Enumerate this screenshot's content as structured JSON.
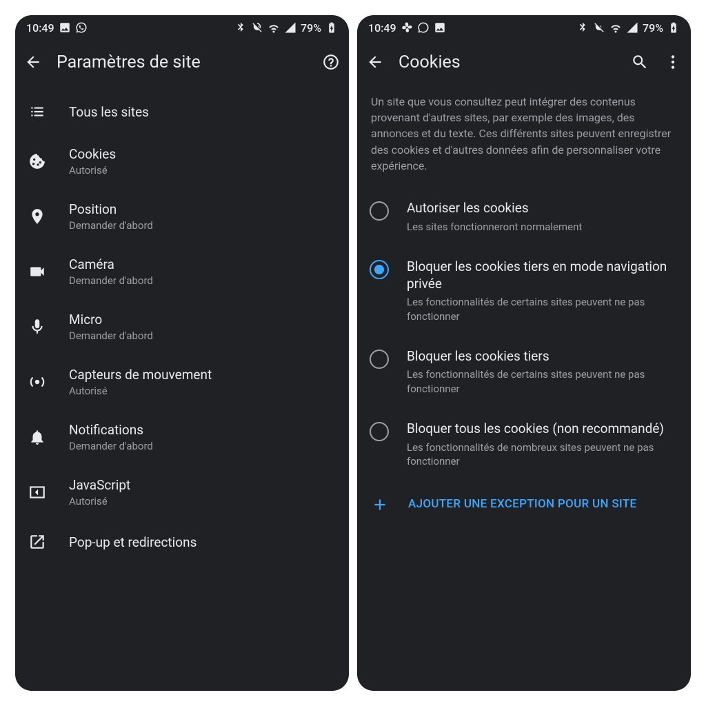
{
  "left": {
    "status": {
      "time": "10:49",
      "battery": "79%"
    },
    "appbar": {
      "title": "Paramètres de site"
    },
    "rows": [
      {
        "label": "Tous les sites",
        "sub": ""
      },
      {
        "label": "Cookies",
        "sub": "Autorisé"
      },
      {
        "label": "Position",
        "sub": "Demander d'abord"
      },
      {
        "label": "Caméra",
        "sub": "Demander d'abord"
      },
      {
        "label": "Micro",
        "sub": "Demander d'abord"
      },
      {
        "label": "Capteurs de mouvement",
        "sub": "Autorisé"
      },
      {
        "label": "Notifications",
        "sub": "Demander d'abord"
      },
      {
        "label": "JavaScript",
        "sub": "Autorisé"
      },
      {
        "label": "Pop-up et redirections",
        "sub": ""
      }
    ]
  },
  "right": {
    "status": {
      "time": "10:49",
      "battery": "79%"
    },
    "appbar": {
      "title": "Cookies"
    },
    "description": "Un site que vous consultez peut intégrer des contenus provenant d'autres sites, par exemple des images, des annonces et du texte. Ces différents sites peuvent enregistrer des cookies et d'autres données afin de personnaliser votre expérience.",
    "options": [
      {
        "label": "Autoriser les cookies",
        "sub": "Les sites fonctionneront normalement",
        "selected": false
      },
      {
        "label": "Bloquer les cookies tiers en mode navigation privée",
        "sub": "Les fonctionnalités de certains sites peuvent ne pas fonctionner",
        "selected": true
      },
      {
        "label": "Bloquer les cookies tiers",
        "sub": "Les fonctionnalités de certains sites peuvent ne pas fonctionner",
        "selected": false
      },
      {
        "label": "Bloquer tous les cookies (non recommandé)",
        "sub": "Les fonctionnalités de nombreux sites peuvent ne pas fonctionner",
        "selected": false
      }
    ],
    "add_exception": "AJOUTER UNE EXCEPTION POUR UN SITE"
  },
  "colors": {
    "accent": "#3ea6ff"
  }
}
